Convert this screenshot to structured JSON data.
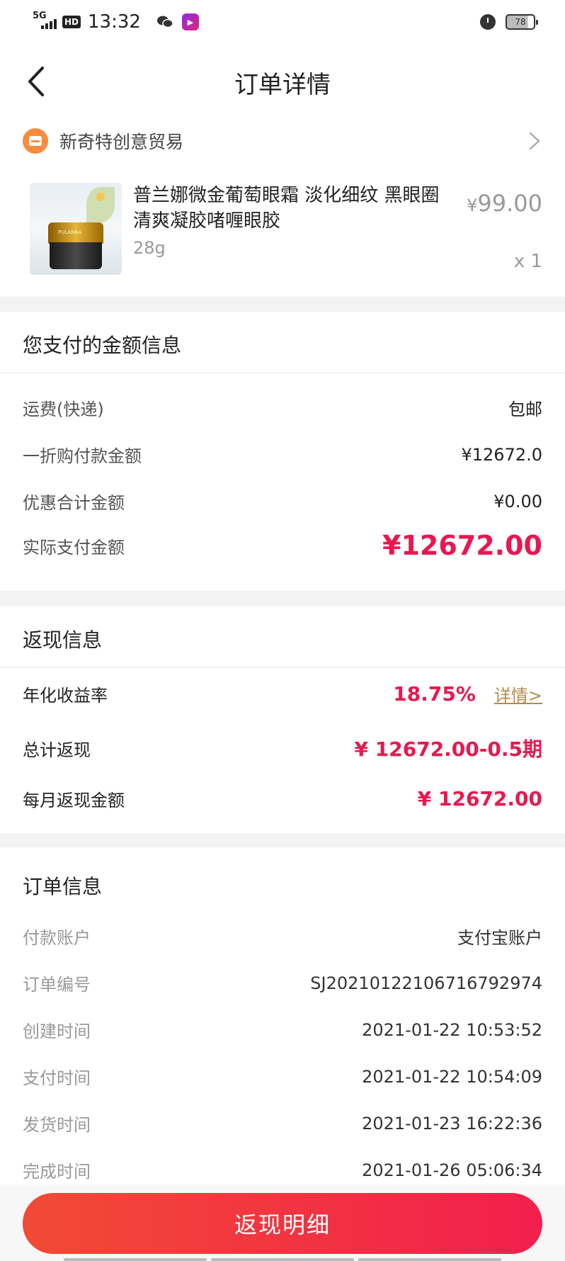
{
  "status_bar": {
    "network": "5G",
    "hd": "HD",
    "time": "13:32",
    "battery": "78"
  },
  "header": {
    "title": "订单详情"
  },
  "shop": {
    "name": "新奇特创意贸易"
  },
  "product": {
    "title": "普兰娜微金葡萄眼霜 淡化细纹 黑眼圈 清爽凝胶啫喱眼胶",
    "spec": "28g",
    "price_symbol": "¥",
    "price": "99.00",
    "qty": "x 1"
  },
  "payment": {
    "title": "您支付的金额信息",
    "rows": [
      {
        "label": "运费(快递)",
        "value": "包邮"
      },
      {
        "label": "一折购付款金额",
        "value": "¥12672.0"
      },
      {
        "label": "优惠合计金额",
        "value": "¥0.00"
      },
      {
        "label": "实际支付金额",
        "value": "¥12672.00"
      }
    ]
  },
  "cashback": {
    "title": "返现信息",
    "annual_rate_label": "年化收益率",
    "annual_rate_value": "18.75%",
    "detail_link": "详情>",
    "total_label": "总计返现",
    "total_value": "¥ 12672.00-0.5期",
    "monthly_label": "每月返现金额",
    "monthly_value": "¥ 12672.00"
  },
  "order": {
    "title": "订单信息",
    "rows": [
      {
        "label": "付款账户",
        "value": "支付宝账户"
      },
      {
        "label": "订单编号",
        "value": "SJ20210122106716792974"
      },
      {
        "label": "创建时间",
        "value": "2021-01-22 10:53:52"
      },
      {
        "label": "支付时间",
        "value": "2021-01-22 10:54:09"
      },
      {
        "label": "发货时间",
        "value": "2021-01-23 16:22:36"
      },
      {
        "label": "完成时间",
        "value": "2021-01-26 05:06:34"
      }
    ]
  },
  "bottom": {
    "button_label": "返现明细"
  },
  "colors": {
    "accent_red": "#e8184f",
    "shop_orange": "#fa8a3c",
    "link_gold": "#b48a4a"
  }
}
